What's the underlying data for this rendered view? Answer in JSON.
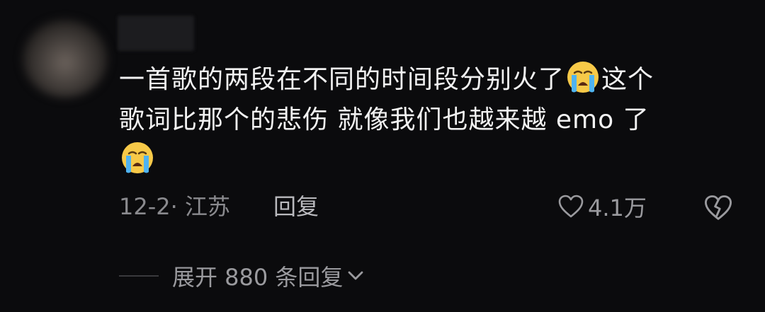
{
  "comment": {
    "text_line1": "一首歌的两段在不同的时间段分别火了",
    "text_line1_tail": "这个",
    "text_line2": "歌词比那个的悲伤 就像我们也越来越 emo 了",
    "emoji_name": "loudly-crying-face"
  },
  "meta": {
    "date_location": "12-2· 江苏",
    "reply_label": "回复",
    "like_count": "4.1万"
  },
  "replies": {
    "expand_label": "展开 880 条回复"
  },
  "colors": {
    "background": "#0b0b0d",
    "text_primary": "#f2f2f2",
    "text_secondary": "#8a8a8e"
  }
}
